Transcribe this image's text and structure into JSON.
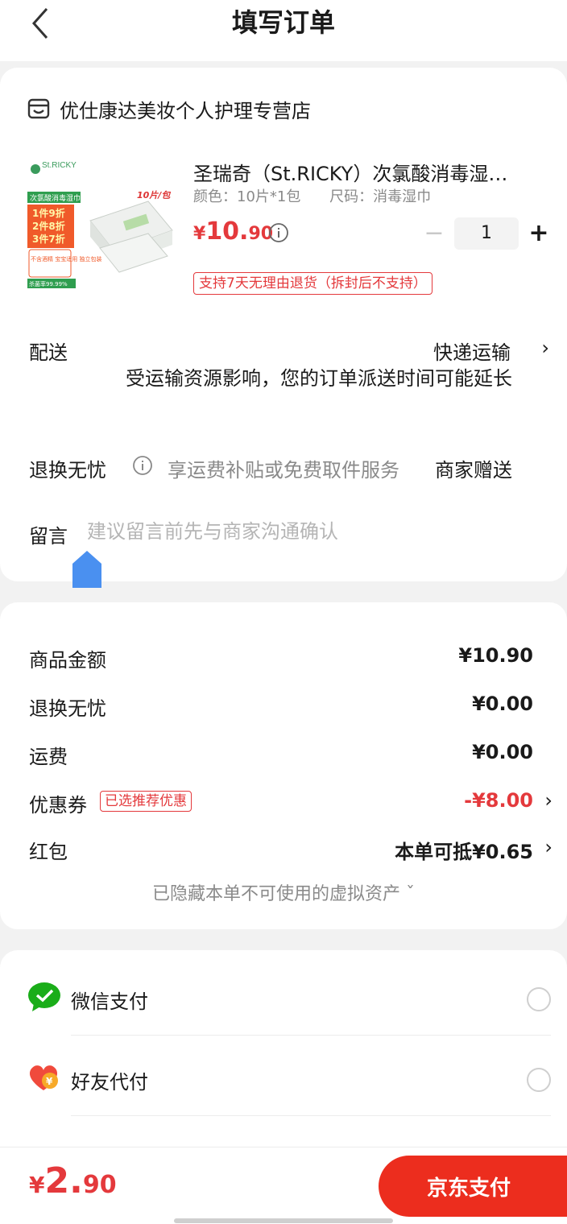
{
  "header": {
    "title": "填写订单",
    "back_icon": "chevron-left-icon"
  },
  "store": {
    "name": "优仕康达美妆个人护理专营店",
    "icon": "store-icon"
  },
  "product": {
    "title": "圣瑞奇（St.RICKY）次氯酸消毒湿…",
    "spec_color": "颜色：10片*1包",
    "spec_size": "尺码：消毒湿巾",
    "price_yen": "¥",
    "price_int": "10.",
    "price_dec": "90",
    "quantity": "1",
    "minus_symbol": "−",
    "plus_symbol": "+",
    "return_policy": "支持7天无理由退货（拆封后不支持）",
    "image": {
      "brand": "St.RICKY",
      "label": "次氯酸消毒湿巾",
      "promo_lines": [
        "1件9折",
        "2件8折",
        "3件7折"
      ],
      "features": "不含酒精 宝宝适用 独立包装",
      "rate": "杀菌率99.99%",
      "pack": "10片/包"
    }
  },
  "delivery": {
    "label": "配送",
    "value": "快递运输",
    "arrow": "›",
    "note": "受运输资源影响，您的订单派送时间可能延长"
  },
  "exchange": {
    "label": "退换无忧",
    "desc": "享运费补贴或免费取件服务",
    "value": "商家赠送"
  },
  "message": {
    "label": "留言",
    "placeholder": "建议留言前先与商家沟通确认",
    "value": ""
  },
  "price_summary": {
    "goods_label": "商品金额",
    "goods_value": "¥10.90",
    "exchange_label": "退换无忧",
    "exchange_value": "¥0.00",
    "shipping_label": "运费",
    "shipping_value": "¥0.00",
    "coupon_label": "优惠券",
    "coupon_tag": "已选推荐优惠",
    "coupon_value": "-¥8.00",
    "redpacket_label": "红包",
    "redpacket_value": "本单可抵¥0.65",
    "arrow": "›",
    "hidden_assets": "已隐藏本单不可使用的虚拟资产 ˇ"
  },
  "payment": {
    "methods": [
      {
        "label": "微信支付",
        "icon": "wechat-pay-icon",
        "color": "#1aad19"
      },
      {
        "label": "好友代付",
        "icon": "friend-pay-icon",
        "color": "#f04a3c"
      }
    ]
  },
  "bottom": {
    "total_yen": "¥",
    "total_int": "2.",
    "total_dec": "90",
    "pay_button": "京东支付"
  },
  "colors": {
    "accent": "#e4393c",
    "pay_button": "#ec2d1e",
    "background": "#f2f2f2"
  }
}
